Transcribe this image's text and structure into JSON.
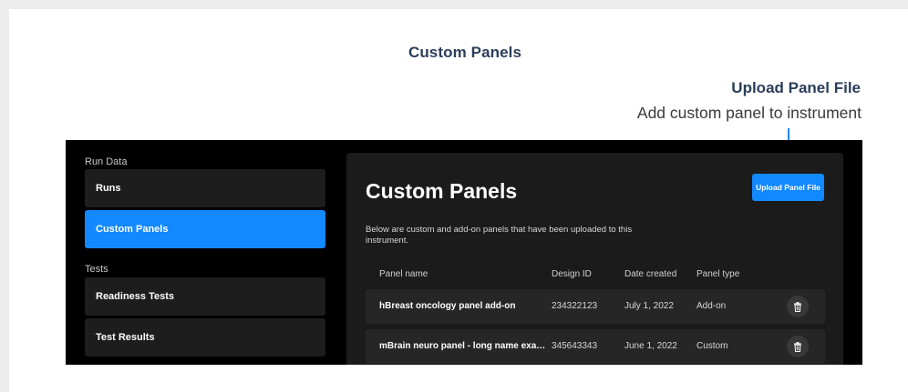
{
  "document": {
    "title": "Custom Panels",
    "callout_title": "Upload Panel File",
    "callout_description": "Add custom panel to instrument"
  },
  "sidebar": {
    "sections": [
      {
        "label": "Run Data",
        "items": [
          {
            "label": "Runs",
            "active": false
          },
          {
            "label": "Custom Panels",
            "active": true
          }
        ]
      },
      {
        "label": "Tests",
        "items": [
          {
            "label": "Readiness Tests",
            "active": false
          },
          {
            "label": "Test Results",
            "active": false
          }
        ]
      }
    ]
  },
  "main": {
    "title": "Custom Panels",
    "upload_button_label": "Upload Panel File",
    "description": "Below are custom and add-on panels that have been uploaded to this instrument.",
    "columns": [
      "Panel name",
      "Design ID",
      "Date created",
      "Panel type"
    ],
    "rows": [
      {
        "name": "hBreast oncology panel add-on",
        "design_id": "234322123",
        "date": "July 1, 2022",
        "type": "Add-on",
        "action_icon": "trash-icon"
      },
      {
        "name": "mBrain neuro panel - long name exampl...",
        "design_id": "345643343",
        "date": "June 1, 2022",
        "type": "Custom",
        "action_icon": "trash-icon"
      }
    ]
  },
  "colors": {
    "accent": "#1289ff",
    "callout_text": "#2b3e5a",
    "app_background": "#000000",
    "panel_background": "#1b1b1b",
    "row_background": "#262626"
  }
}
